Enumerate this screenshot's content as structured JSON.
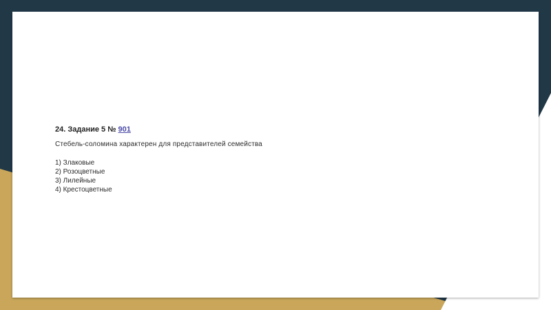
{
  "colors": {
    "background_dark": "#213847",
    "background_gold": "#c9a65a",
    "slide": "#ffffff",
    "link": "#4a4aa8"
  },
  "task": {
    "heading_prefix": "24. Задание 5 № ",
    "number_link": "901",
    "question": "Стебель-соломина характерен для представителей семейства",
    "options": [
      "1) Злаковые",
      "2) Розоцветные",
      "3) Лилейные",
      "4) Крестоцветные"
    ]
  }
}
